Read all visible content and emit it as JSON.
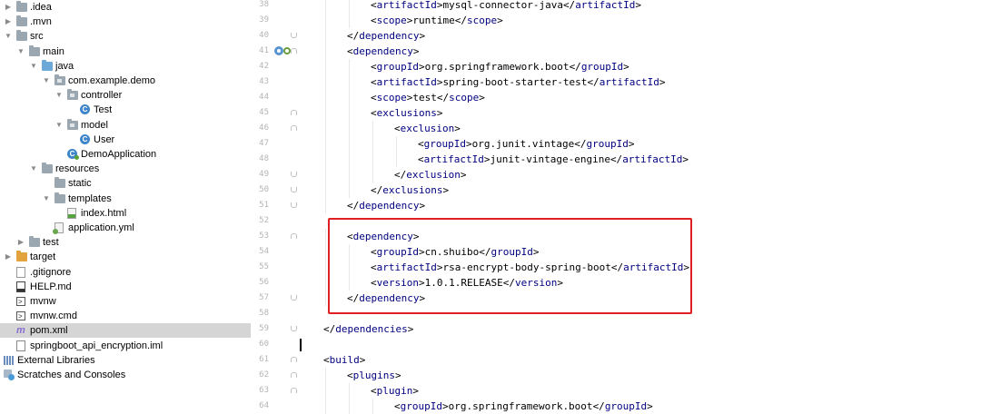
{
  "project_tree": [
    {
      "label": ".idea",
      "depth": 0,
      "arrow": "right",
      "icon": "folder"
    },
    {
      "label": ".mvn",
      "depth": 0,
      "arrow": "right",
      "icon": "folder"
    },
    {
      "label": "src",
      "depth": 0,
      "arrow": "down",
      "icon": "folder"
    },
    {
      "label": "main",
      "depth": 1,
      "arrow": "down",
      "icon": "folder"
    },
    {
      "label": "java",
      "depth": 2,
      "arrow": "down",
      "icon": "folder-blue"
    },
    {
      "label": "com.example.demo",
      "depth": 3,
      "arrow": "down",
      "icon": "package"
    },
    {
      "label": "controller",
      "depth": 4,
      "arrow": "down",
      "icon": "package"
    },
    {
      "label": "Test",
      "depth": 5,
      "arrow": "",
      "icon": "class"
    },
    {
      "label": "model",
      "depth": 4,
      "arrow": "down",
      "icon": "package"
    },
    {
      "label": "User",
      "depth": 5,
      "arrow": "",
      "icon": "class"
    },
    {
      "label": "DemoApplication",
      "depth": 4,
      "arrow": "",
      "icon": "spring-class"
    },
    {
      "label": "resources",
      "depth": 2,
      "arrow": "down",
      "icon": "folder-resources"
    },
    {
      "label": "static",
      "depth": 3,
      "arrow": "",
      "icon": "folder"
    },
    {
      "label": "templates",
      "depth": 3,
      "arrow": "down",
      "icon": "folder"
    },
    {
      "label": "index.html",
      "depth": 4,
      "arrow": "",
      "icon": "html-file"
    },
    {
      "label": "application.yml",
      "depth": 3,
      "arrow": "",
      "icon": "yml-file"
    },
    {
      "label": "test",
      "depth": 1,
      "arrow": "right",
      "icon": "folder"
    },
    {
      "label": "target",
      "depth": 0,
      "arrow": "right",
      "icon": "folder-orange"
    },
    {
      "label": ".gitignore",
      "depth": 0,
      "arrow": "",
      "icon": "git-file"
    },
    {
      "label": "HELP.md",
      "depth": 0,
      "arrow": "",
      "icon": "md-file"
    },
    {
      "label": "mvnw",
      "depth": 0,
      "arrow": "",
      "icon": "terminal-file"
    },
    {
      "label": "mvnw.cmd",
      "depth": 0,
      "arrow": "",
      "icon": "terminal-file"
    },
    {
      "label": "pom.xml",
      "depth": 0,
      "arrow": "",
      "icon": "maven-file",
      "selected": true
    },
    {
      "label": "springboot_api_encryption.iml",
      "depth": 0,
      "arrow": "",
      "icon": "iml-file"
    },
    {
      "label": "External Libraries",
      "depth": -1,
      "arrow": "right",
      "icon": "libraries"
    },
    {
      "label": "Scratches and Consoles",
      "depth": -1,
      "arrow": "",
      "icon": "scratches"
    }
  ],
  "code_lines": [
    {
      "num": "38",
      "indent": 3,
      "tag": "artifactId",
      "text": "mysql-connector-java"
    },
    {
      "num": "39",
      "indent": 3,
      "tag": "scope",
      "text": "runtime"
    },
    {
      "num": "40",
      "indent": 2,
      "tag": "/dependency",
      "text": ""
    },
    {
      "num": "41",
      "indent": 2,
      "tag": "dependency",
      "text": ""
    },
    {
      "num": "42",
      "indent": 3,
      "tag": "groupId",
      "text": "org.springframework.boot"
    },
    {
      "num": "43",
      "indent": 3,
      "tag": "artifactId",
      "text": "spring-boot-starter-test"
    },
    {
      "num": "44",
      "indent": 3,
      "tag": "scope",
      "text": "test"
    },
    {
      "num": "45",
      "indent": 3,
      "tag": "exclusions",
      "text": ""
    },
    {
      "num": "46",
      "indent": 4,
      "tag": "exclusion",
      "text": ""
    },
    {
      "num": "47",
      "indent": 5,
      "tag": "groupId",
      "text": "org.junit.vintage"
    },
    {
      "num": "48",
      "indent": 5,
      "tag": "artifactId",
      "text": "junit-vintage-engine"
    },
    {
      "num": "49",
      "indent": 4,
      "tag": "/exclusion",
      "text": ""
    },
    {
      "num": "50",
      "indent": 3,
      "tag": "/exclusions",
      "text": ""
    },
    {
      "num": "51",
      "indent": 2,
      "tag": "/dependency",
      "text": ""
    },
    {
      "num": "52",
      "indent": 0,
      "tag": "",
      "text": ""
    },
    {
      "num": "53",
      "indent": 2,
      "tag": "dependency",
      "text": ""
    },
    {
      "num": "54",
      "indent": 3,
      "tag": "groupId",
      "text": "cn.shuibo"
    },
    {
      "num": "55",
      "indent": 3,
      "tag": "artifactId",
      "text": "rsa-encrypt-body-spring-boot"
    },
    {
      "num": "56",
      "indent": 3,
      "tag": "version",
      "text": "1.0.1.RELEASE"
    },
    {
      "num": "57",
      "indent": 2,
      "tag": "/dependency",
      "text": ""
    },
    {
      "num": "58",
      "indent": 0,
      "tag": "",
      "text": ""
    },
    {
      "num": "59",
      "indent": 1,
      "tag": "/dependencies",
      "text": ""
    },
    {
      "num": "60",
      "indent": 0,
      "tag": "",
      "text": "",
      "caret": true
    },
    {
      "num": "61",
      "indent": 1,
      "tag": "build",
      "text": ""
    },
    {
      "num": "62",
      "indent": 2,
      "tag": "plugins",
      "text": ""
    },
    {
      "num": "63",
      "indent": 3,
      "tag": "plugin",
      "text": ""
    },
    {
      "num": "64",
      "indent": 4,
      "tag": "groupId",
      "text": "org.springframework.boot"
    }
  ],
  "colors": {
    "tag": "#000080",
    "highlight_box": "#e02020",
    "selection": "#d5d5d5"
  }
}
